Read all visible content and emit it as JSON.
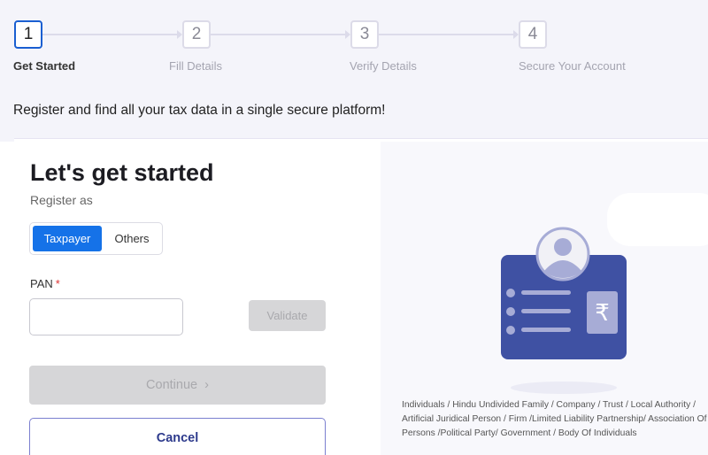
{
  "stepper": {
    "steps": [
      {
        "number": "1",
        "label": "Get Started",
        "active": true
      },
      {
        "number": "2",
        "label": "Fill Details",
        "active": false
      },
      {
        "number": "3",
        "label": "Verify Details",
        "active": false
      },
      {
        "number": "4",
        "label": "Secure Your Account",
        "active": false
      }
    ]
  },
  "tagline": "Register and find all your tax data in a single secure platform!",
  "form": {
    "title": "Let's get started",
    "subtitle": "Register as",
    "register_options": [
      {
        "label": "Taxpayer",
        "selected": true
      },
      {
        "label": "Others",
        "selected": false
      }
    ],
    "pan_label": "PAN",
    "required_mark": "*",
    "pan_value": "",
    "validate_label": "Validate",
    "continue_label": "Continue",
    "continue_icon": "chevron-right-icon",
    "continue_glyph": "›",
    "cancel_label": "Cancel"
  },
  "illustration": {
    "icon": "id-card-rupee-icon",
    "rupee_glyph": "₹",
    "colors": {
      "card": "#3f51a3",
      "accent": "#a7acd6",
      "avatar_bg": "#f1f1f6"
    }
  },
  "description": "Individuals / Hindu Undivided Family / Company / Trust / Local Authority / Artificial Juridical Person / Firm /Limited Liability Partnership/ Association Of Persons /Political Party/ Government / Body Of Individuals",
  "colors": {
    "primary": "#1572e8",
    "active_step_border": "#1a5fd1",
    "cancel_text": "#2d3a8c",
    "required": "#dd3333"
  }
}
